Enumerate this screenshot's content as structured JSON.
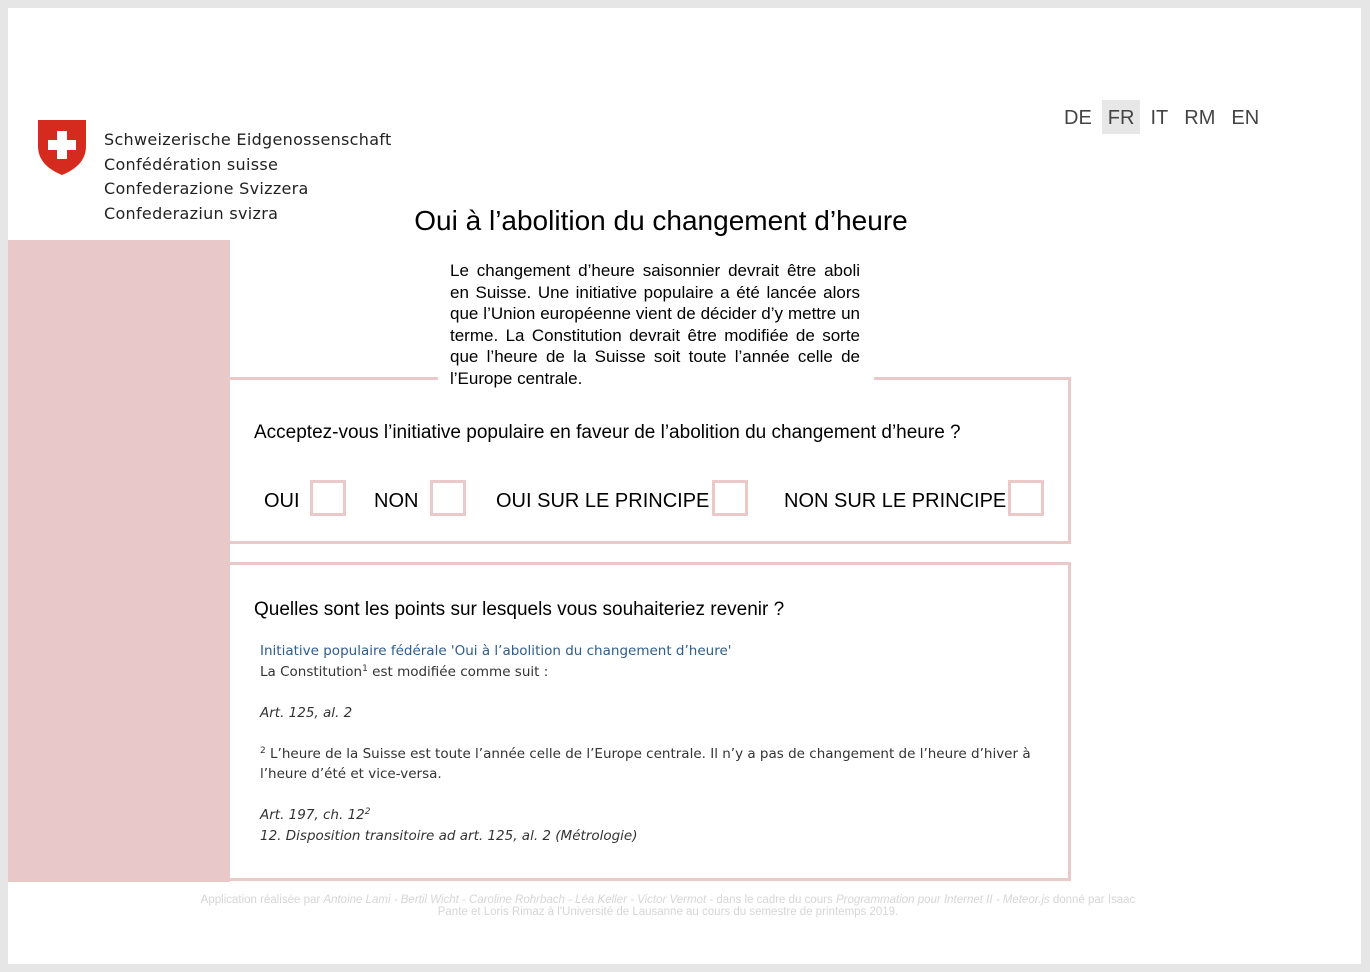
{
  "header": {
    "logo_lines": [
      "Schweizerische Eidgenossenschaft",
      "Confédération suisse",
      "Confederazione Svizzera",
      "Confederaziun svizra"
    ],
    "brand_color": "#d52b1e",
    "languages": [
      "DE",
      "FR",
      "IT",
      "RM",
      "EN"
    ],
    "active_language": "FR"
  },
  "main": {
    "title": "Oui à l’abolition du changement d’heure",
    "intro": "Le changement d’heure saisonnier devrait être aboli en Suisse. Une initiative populaire  a été lancée alors que l’Union européenne vient de décider d’y mettre un terme. La Constitution devrait être modifiée de sorte que l’heure de la Suisse soit toute l’année celle de l’Europe centrale."
  },
  "vote": {
    "question": "Acceptez-vous l’initiative populaire en  faveur de l’abolition du changement d’heure ?",
    "options": [
      "OUI",
      "NON",
      "OUI SUR LE PRINCIPE",
      "NON SUR LE PRINCIPE"
    ]
  },
  "details": {
    "question": "Quelles sont les points sur lesquels vous souhaiteriez revenir ?",
    "initiative_link": "Initiative populaire fédérale 'Oui à l’abolition du changement d’heure'",
    "constitution_prefix": "La Constitution",
    "constitution_sup": "1",
    "constitution_suffix": " est modifiée comme suit :",
    "art1": "Art. 125, al. 2",
    "para_sup": "2",
    "para_text": " L’heure de la Suisse est toute l’année celle de l’Europe centrale. Il n’y a pas de changement de l’heure d’hiver à l’heure d’été et vice-versa.",
    "art2": "Art. 197, ch. 12",
    "art2_sup": "2",
    "transitional": "12. Disposition transitoire ad art. 125, al. 2 (Métrologie)"
  },
  "footer": {
    "part1": "Application réalisée par ",
    "authors": "Antoine Lami - Bertil Wicht - Caroline Rohrbach - Léa Keller - Victor Vermot",
    "part2": " - dans le cadre du cours ",
    "course": "Programmation pour Internet II - Meteor.js",
    "part3": " donné par Isaac Pante et Loris Rimaz à l'Université de Lausanne au cours du semestre de printemps 2019."
  },
  "colors": {
    "accent_pink": "#e8c8c8",
    "border_pink": "#ecc9c9",
    "link_blue": "#2e5c8c"
  }
}
